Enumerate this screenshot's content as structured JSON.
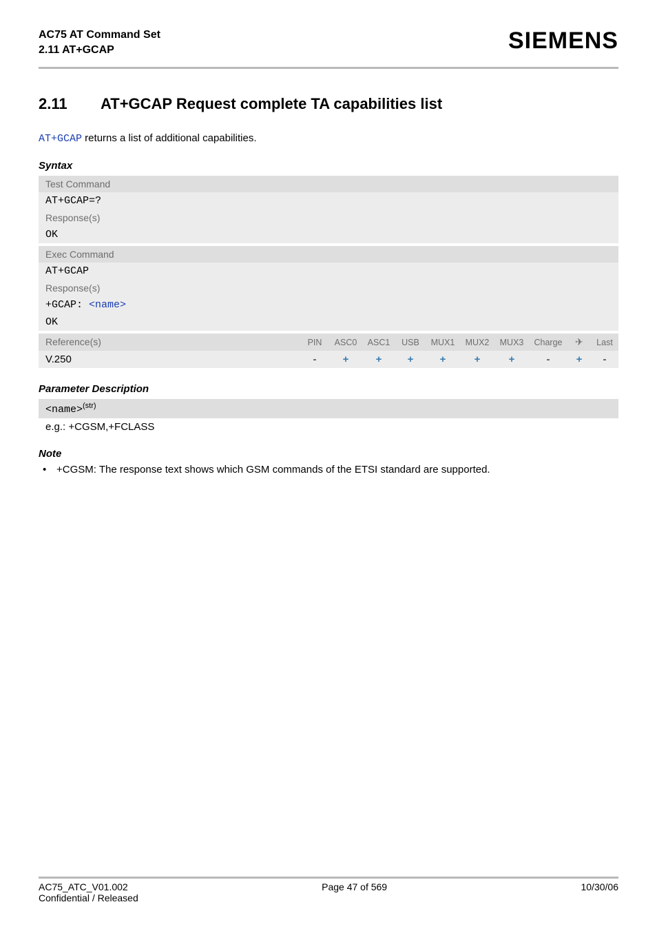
{
  "header": {
    "title_line1": "AC75 AT Command Set",
    "title_line2": "2.11 AT+GCAP",
    "brand": "SIEMENS"
  },
  "section": {
    "number": "2.11",
    "title": "AT+GCAP   Request complete TA capabilities list"
  },
  "intro": {
    "link": "AT+GCAP",
    "text_after": " returns a list of additional capabilities."
  },
  "subheads": {
    "syntax": "Syntax",
    "param": "Parameter Description",
    "note": "Note"
  },
  "syntax": {
    "test_label": "Test Command",
    "test_cmd": "AT+GCAP=?",
    "test_resp_label": "Response(s)",
    "test_resp": "OK",
    "exec_label": "Exec Command",
    "exec_cmd": "AT+GCAP",
    "exec_resp_label": "Response(s)",
    "exec_resp_prefix": "+GCAP: ",
    "exec_resp_param": "<name>",
    "exec_resp_ok": "OK",
    "ref_label": "Reference(s)",
    "ref_value": "V.250",
    "columns": [
      "PIN",
      "ASC0",
      "ASC1",
      "USB",
      "MUX1",
      "MUX2",
      "MUX3",
      "Charge",
      "",
      "Last"
    ],
    "airplane_glyph": "✈",
    "values": [
      "-",
      "+",
      "+",
      "+",
      "+",
      "+",
      "+",
      "-",
      "+",
      "-"
    ]
  },
  "param": {
    "name": "<name>",
    "sup": "(str)",
    "desc": "e.g.: +CGSM,+FCLASS"
  },
  "note": {
    "bullet": "•",
    "text": "+CGSM: The response text shows which GSM commands of the ETSI standard are supported."
  },
  "footer": {
    "left1": "AC75_ATC_V01.002",
    "center": "Page 47 of 569",
    "right": "10/30/06",
    "left2": "Confidential / Released"
  }
}
